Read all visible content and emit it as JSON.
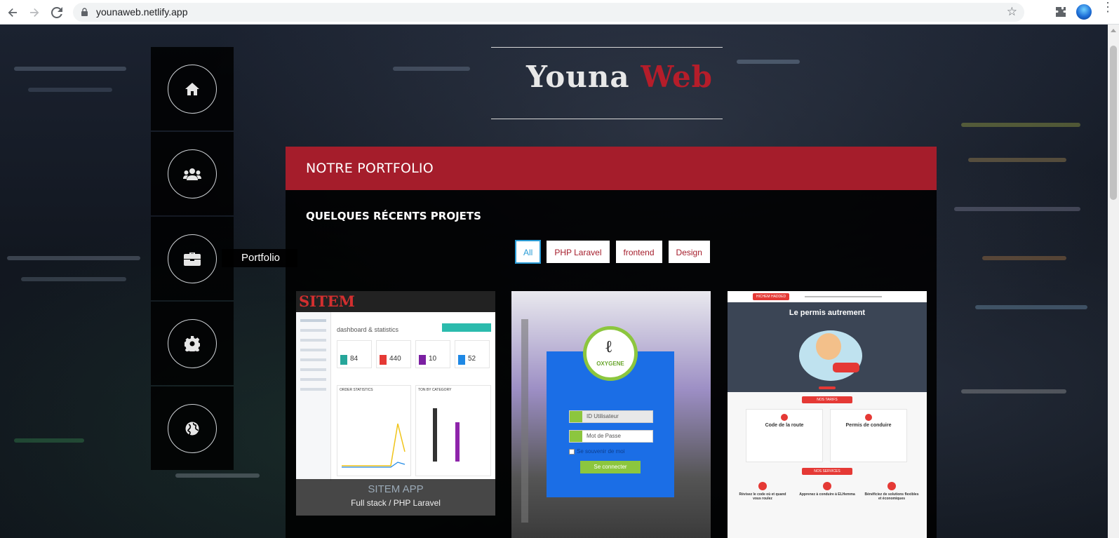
{
  "browser": {
    "url": "younaweb.netlify.app"
  },
  "sidenav": {
    "items": [
      {
        "icon": "home-icon"
      },
      {
        "icon": "users-icon"
      },
      {
        "icon": "briefcase-icon"
      },
      {
        "icon": "gear-icon"
      },
      {
        "icon": "globe-icon"
      }
    ],
    "tooltip": "Portfolio"
  },
  "logo": {
    "part1": "Youna",
    "part2": "Web"
  },
  "portfolio": {
    "title": "NOTRE PORTFOLIO",
    "subtitle": "QUELQUES RÉCENTS PROJETS",
    "filters": [
      "All",
      "PHP Laravel",
      "frontend",
      "Design"
    ],
    "active_filter": "All",
    "projects": [
      {
        "title": "SITEM APP",
        "subtitle": "Full stack / PHP Laravel",
        "brand": "SITEM",
        "dashboard_heading": "dashboard & statistics",
        "stats": [
          "84",
          "440",
          "10",
          "52"
        ],
        "panel1": "ORDER STATISTICS",
        "panel2": "TON BY CATEGORY"
      },
      {
        "brand": "OXYGENE",
        "login_user": "ID Utilisateur",
        "login_pass": "Mot de Passe",
        "remember": "Se souvenir de moi",
        "submit": "Se connecter"
      },
      {
        "brand": "HICHEM HADDED",
        "headline": "Le permis autrement",
        "section1": "NOS TARIFS",
        "card1": "Code de la route",
        "card2": "Permis de conduire",
        "section2": "NOS SERVICES",
        "service1": "Révisez le code où et quand vous roulez",
        "service2": "Apprenez à conduire à ELHemma",
        "service3": "Bénéficiez de solutions flexibles et économiques"
      }
    ]
  },
  "colors": {
    "accent": "#a51d2b",
    "active_filter": "#2a9cd6"
  }
}
